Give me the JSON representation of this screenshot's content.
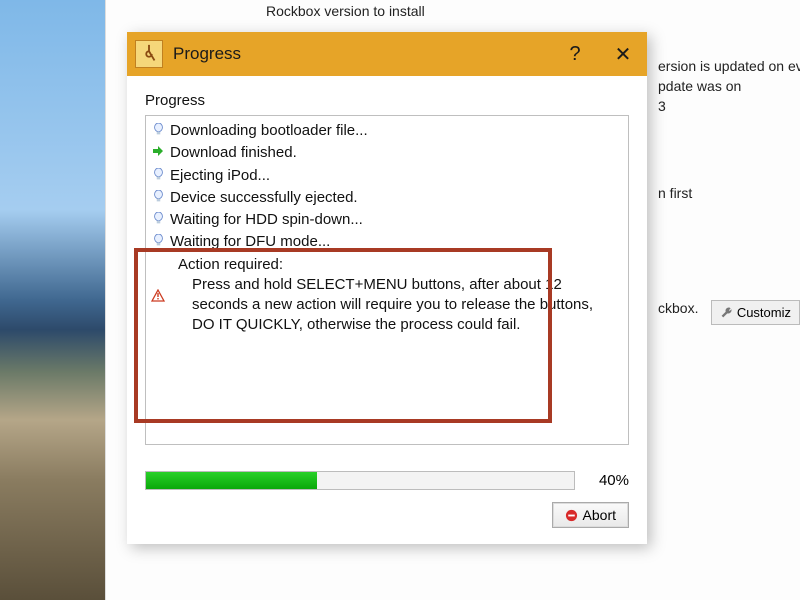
{
  "background": {
    "group_label": "Rockbox version to install",
    "line_a1": "ersion is updated on ever",
    "line_a2": "pdate was on",
    "line_a3": "3",
    "line_b": "n first",
    "line_c": "ckbox.",
    "customize_label": "Customiz"
  },
  "dialog": {
    "title": "Progress",
    "section_label": "Progress",
    "log": [
      {
        "icon": "bulb",
        "text": "Downloading bootloader file..."
      },
      {
        "icon": "arrow",
        "text": "Download finished."
      },
      {
        "icon": "bulb",
        "text": "Ejecting iPod..."
      },
      {
        "icon": "bulb",
        "text": "Device successfully ejected."
      },
      {
        "icon": "bulb",
        "text": "Waiting for HDD spin-down..."
      },
      {
        "icon": "bulb",
        "text": "Waiting for DFU mode..."
      }
    ],
    "warning": {
      "heading": "Action required:",
      "body": "Press and hold SELECT+MENU buttons, after about 12 seconds a new action will require you to release the buttons, DO IT QUICKLY, otherwise the process could fail."
    },
    "progress_pct": 40,
    "progress_label": "40%",
    "abort_label": "Abort"
  }
}
